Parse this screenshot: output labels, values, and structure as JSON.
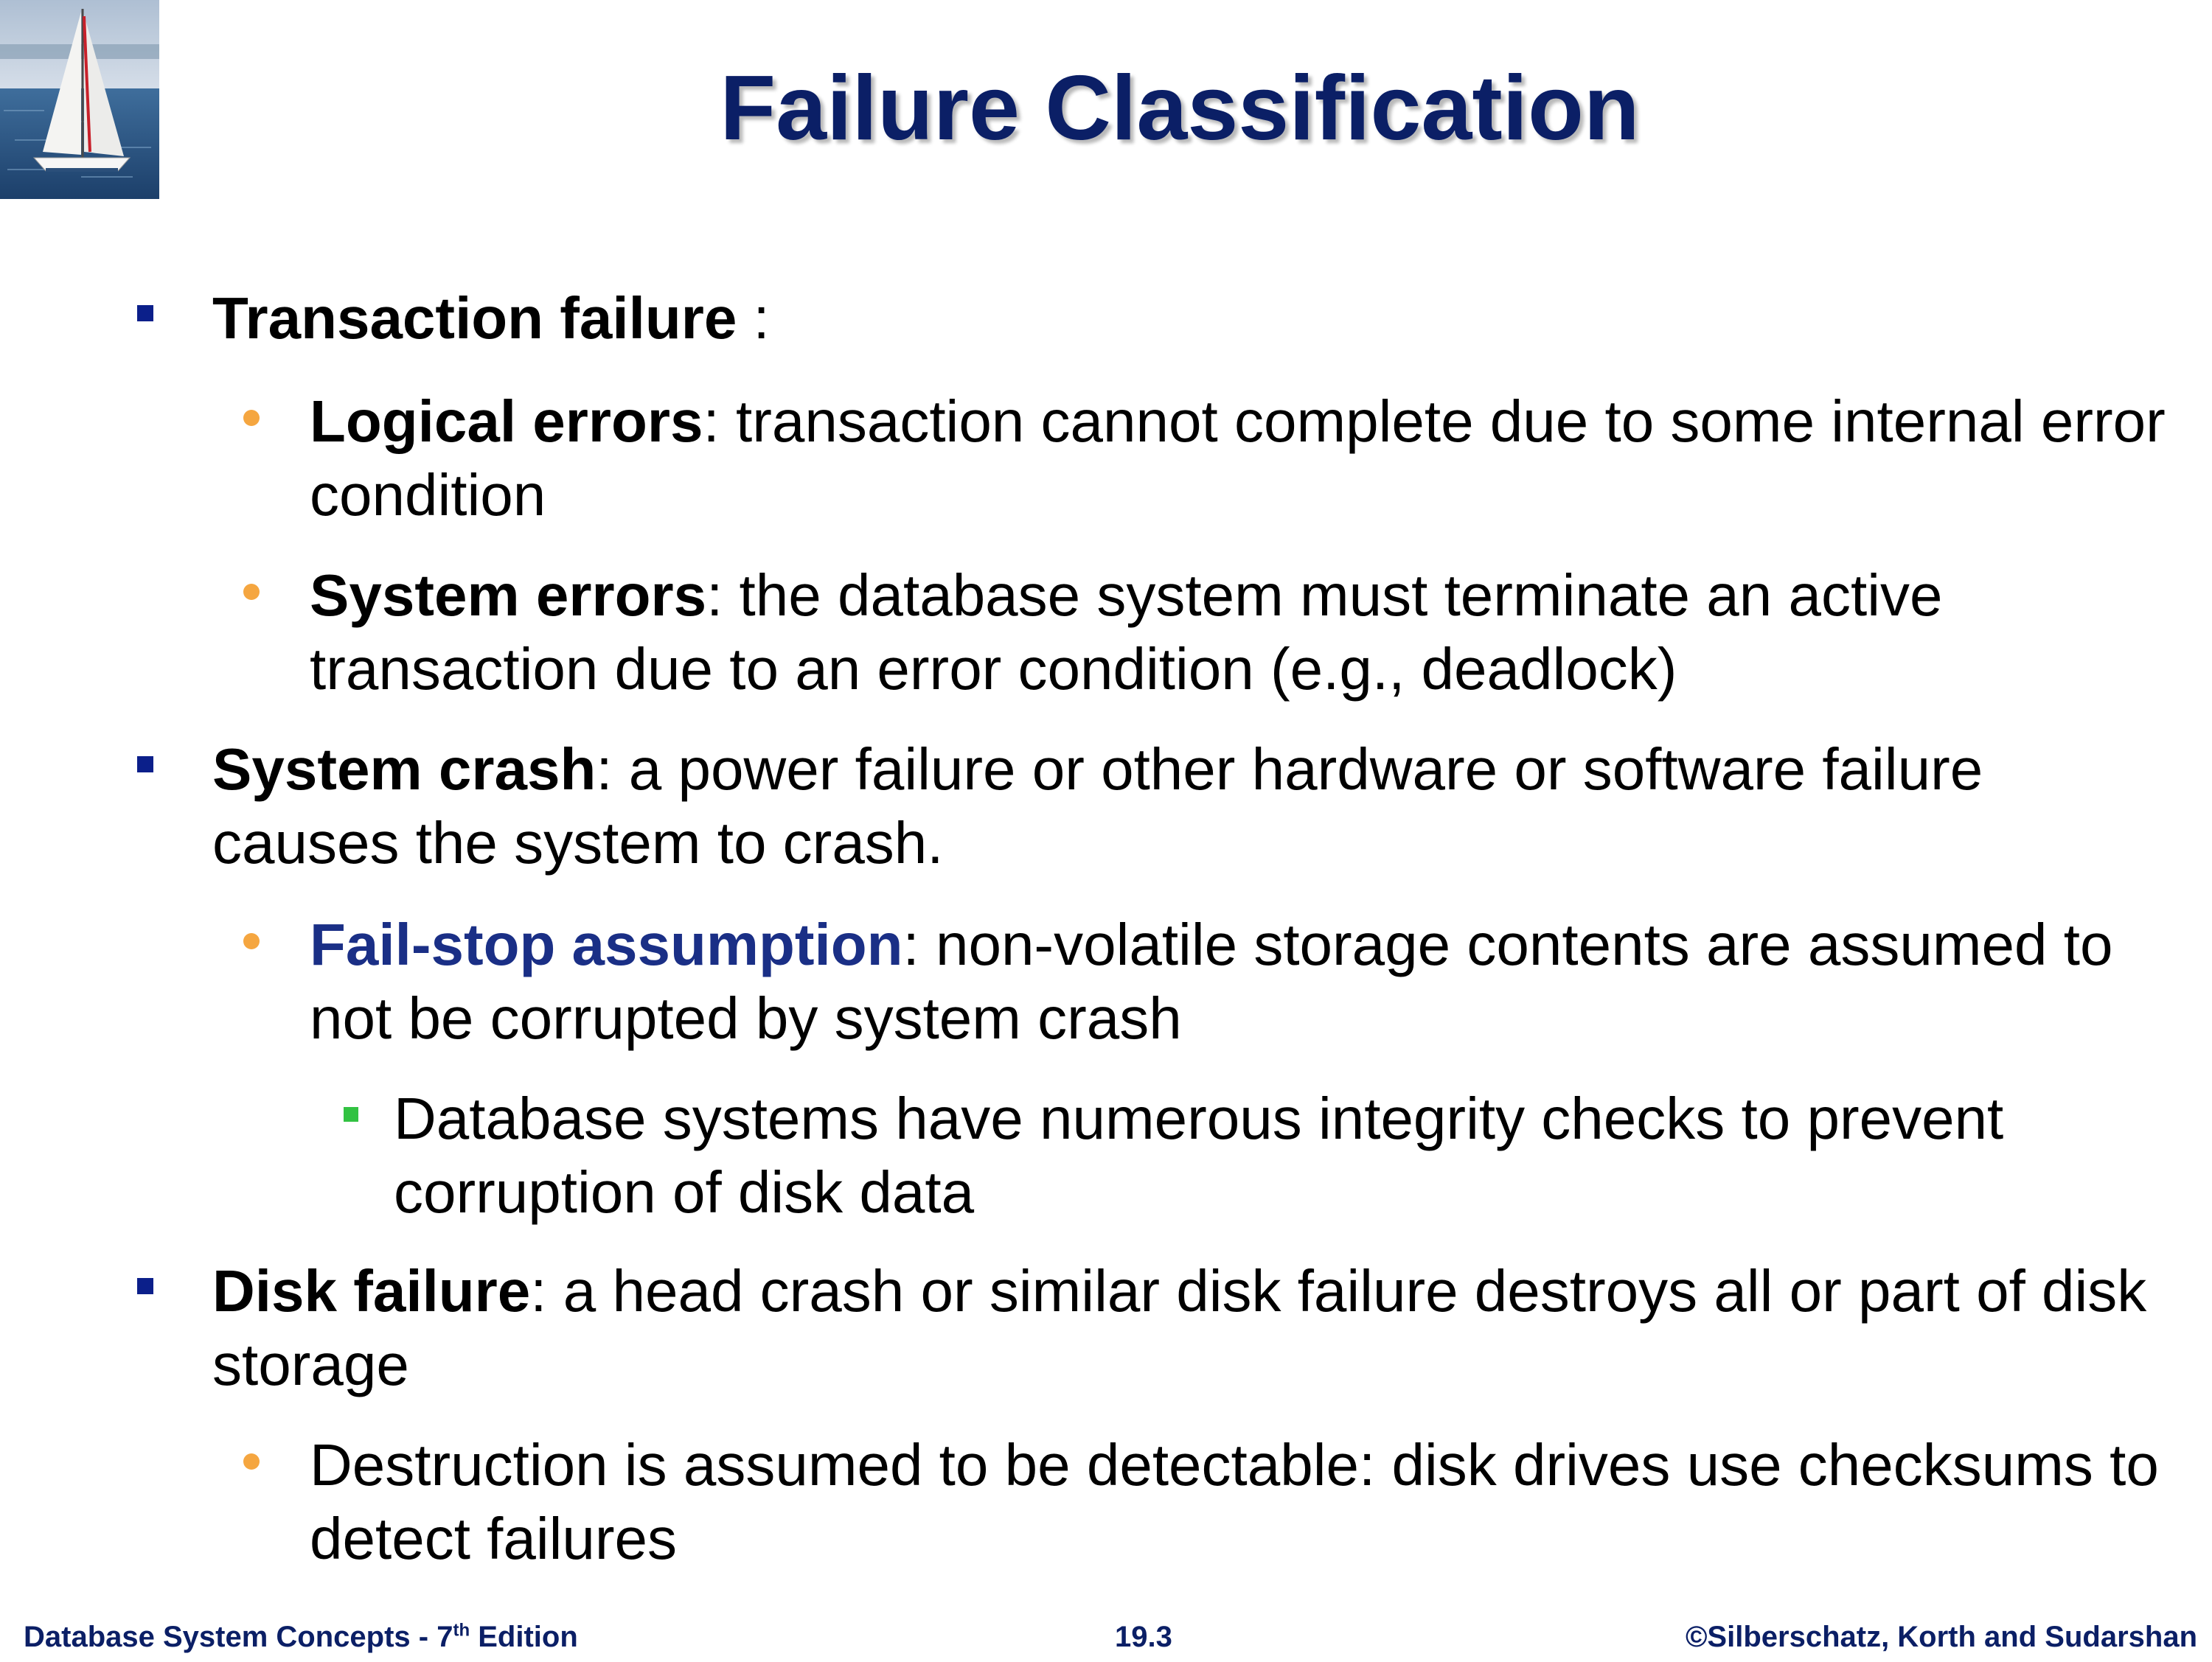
{
  "slide": {
    "title": "Failure Classification",
    "logo": {
      "icon": "sailboat-logo",
      "alt": ""
    },
    "bullets": [
      {
        "level": 1,
        "bold": "Transaction failure",
        "text": " :"
      },
      {
        "level": 2,
        "bold": "Logical errors",
        "text": ": transaction cannot complete due to some internal error condition"
      },
      {
        "level": 2,
        "bold": "System errors",
        "text": ": the database system must terminate an active transaction due to an error condition (e.g., deadlock)"
      },
      {
        "level": 1,
        "bold": "System crash",
        "text": ": a power failure or other hardware or software failure causes the system to crash."
      },
      {
        "level": 2,
        "bold": "Fail-stop assumption",
        "text": ": non-volatile storage contents are assumed to not be corrupted by system crash"
      },
      {
        "level": 3,
        "bold": "",
        "text": "Database systems have numerous integrity checks to prevent corruption of disk data"
      },
      {
        "level": 1,
        "bold": "Disk failure",
        "text": ": a head crash or similar disk failure destroys all or part of disk storage"
      },
      {
        "level": 2,
        "bold": "",
        "text": "Destruction is assumed to be detectable: disk drives use checksums to detect failures"
      }
    ],
    "footer": {
      "left_text": "Database System Concepts - 7",
      "left_sup": "th",
      "left_suffix": " Edition",
      "center": "19.3",
      "right": "©Silberschatz, Korth and Sudarshan"
    }
  },
  "colors": {
    "title": "#0b1f66",
    "level1_bullet": "#0b1f8a",
    "level2_bullet": "#f5a640",
    "level3_bullet": "#32c242",
    "highlight_term": "#1a2f86",
    "footer": "#0b1f66"
  }
}
